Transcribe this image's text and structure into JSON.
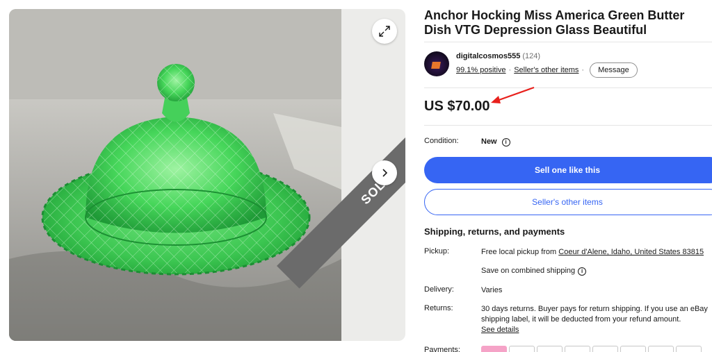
{
  "gallery": {
    "image_alt": "Green depression glass butter dish with lid",
    "sold_label": "SOLD",
    "expand_icon": "expand-icon",
    "next_icon": "chevron-right-icon"
  },
  "listing": {
    "title": "Anchor Hocking Miss America Green Butter Dish VTG Depression Glass Beautiful",
    "price": "US $70.00"
  },
  "seller": {
    "name": "digitalcosmos555",
    "feedback_count": "(124)",
    "positive": "99.1% positive",
    "other_items_link": "Seller's other items",
    "message_button": "Message"
  },
  "condition": {
    "label": "Condition:",
    "value": "New"
  },
  "actions": {
    "primary": "Sell one like this",
    "secondary": "Seller's other items"
  },
  "shipping": {
    "heading": "Shipping, returns, and payments",
    "pickup_label": "Pickup:",
    "pickup_prefix": "Free local pickup from ",
    "pickup_location": "Coeur d'Alene, Idaho, United States 83815",
    "combined": "Save on combined shipping",
    "delivery_label": "Delivery:",
    "delivery_value": "Varies",
    "returns_label": "Returns:",
    "returns_value": "30 days returns. Buyer pays for return shipping. If you use an eBay shipping label, it will be deducted from your refund amount.",
    "see_details": "See details",
    "payments_label": "Payments:"
  },
  "colors": {
    "accent": "#3665f3",
    "annotation_arrow": "#e8201c"
  }
}
